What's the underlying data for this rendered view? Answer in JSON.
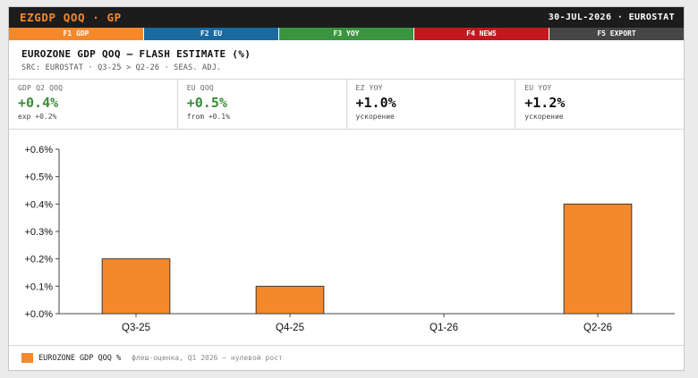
{
  "titlebar": {
    "ticker": "EZGDP QOQ · GP",
    "date_source": "30-JUL-2026 · EUROSTAT"
  },
  "fkeys": [
    {
      "label": "F1 GDP",
      "color": "#f5882b"
    },
    {
      "label": "F2 EU",
      "color": "#1a6aa0"
    },
    {
      "label": "F3 YOY",
      "color": "#3a9440"
    },
    {
      "label": "F4 NEWS",
      "color": "#c2181e"
    },
    {
      "label": "F5 EXPORT",
      "color": "#464646"
    }
  ],
  "header": {
    "title": "EUROZONE GDP QOQ — FLASH ESTIMATE (%)",
    "source": "SRC: EUROSTAT · Q3-25 > Q2-26 · SEAS. ADJ."
  },
  "metrics": [
    {
      "label": "GDP Q2 QOQ",
      "value": "+0.4%",
      "sub": "exp +0.2%",
      "color": "#3a8a3a"
    },
    {
      "label": "EU QOQ",
      "value": "+0.5%",
      "sub": "from +0.1%",
      "color": "#3a8a3a"
    },
    {
      "label": "EZ YOY",
      "value": "+1.0%",
      "sub": "ускорение",
      "color": "#111111"
    },
    {
      "label": "EU YOY",
      "value": "+1.2%",
      "sub": "ускорение",
      "color": "#111111"
    }
  ],
  "chart_data": {
    "type": "bar",
    "categories": [
      "Q3-25",
      "Q4-25",
      "Q1-26",
      "Q2-26"
    ],
    "series": [
      {
        "name": "EUROZONE GDP QOQ %",
        "values": [
          0.2,
          0.1,
          0.0,
          0.4
        ],
        "color": "#f5882b"
      }
    ],
    "yticks": [
      "+0.0%",
      "+0.1%",
      "+0.2%",
      "+0.3%",
      "+0.4%",
      "+0.5%",
      "+0.6%"
    ],
    "ylim": [
      0,
      0.6
    ],
    "grid": false,
    "legend_position": "bottom-left"
  },
  "legend": {
    "note": "флеш-оценка, Q1 2026 — нулевой рост"
  }
}
